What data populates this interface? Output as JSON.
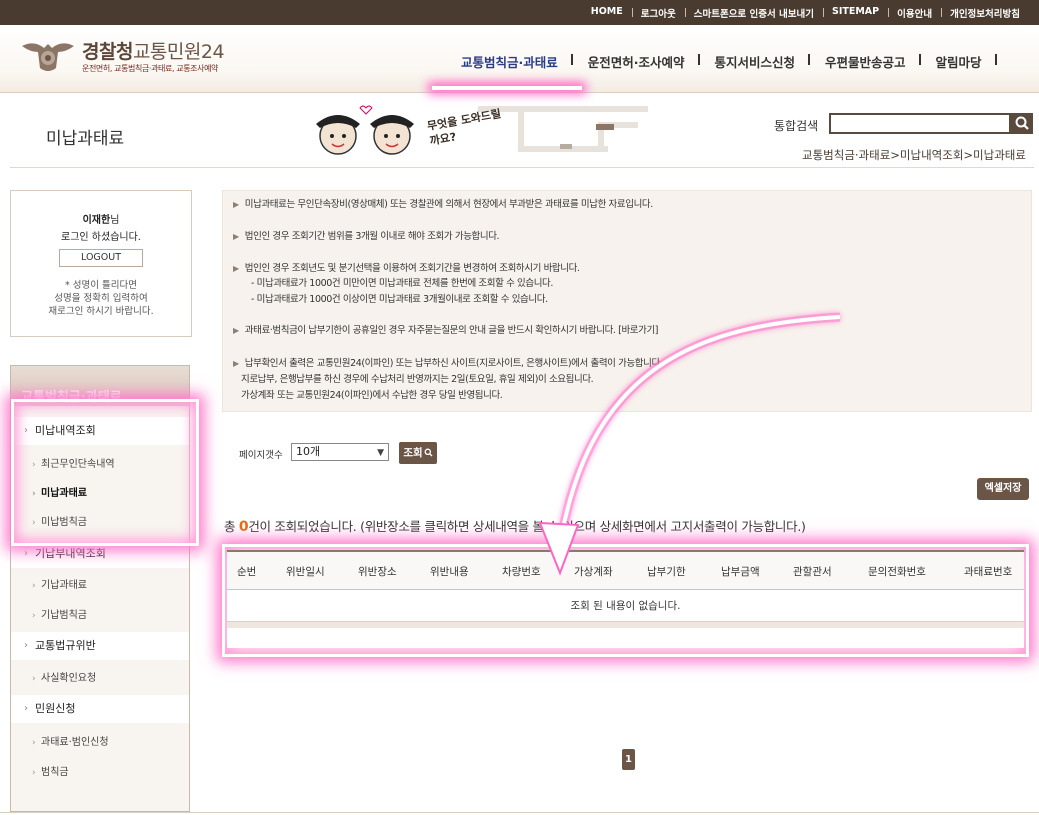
{
  "topbar": {
    "links": [
      "HOME",
      "로그아웃",
      "스마트폰으로 인증서 내보내기",
      "SITEMAP",
      "이용안내",
      "개인정보처리방침"
    ]
  },
  "header": {
    "logo_title_1": "경찰청",
    "logo_title_2": "교통민원24",
    "logo_sub": "운전면허, 교통범칙금·과태료, 교통조사예약",
    "gnb": [
      "교통범칙금·과태료",
      "운전면허·조사예약",
      "통지서비스신청",
      "우편물반송공고",
      "알림마당"
    ],
    "active_gnb_index": 0
  },
  "page": {
    "title": "미납과태료",
    "illust_text": "무엇을 도와드릴까요?",
    "search_label": "통합검색",
    "search_value": "",
    "breadcrumb": "교통범칙금·과태료>미납내역조회>미납과태료"
  },
  "login": {
    "user": "이재한",
    "suffix": "님",
    "welcome": "로그인 하셨습니다.",
    "logout_label": "LOGOUT",
    "note_1": "* 성명이 틀리다면",
    "note_2": "성명을 정확히 입력하여",
    "note_3": "재로그인 하시기 바랍니다."
  },
  "lnb": {
    "title": "교통범칙금·과태료",
    "items": [
      {
        "type": "main",
        "label": "미납내역조회"
      },
      {
        "type": "sub",
        "label": "최근무인단속내역"
      },
      {
        "type": "sub",
        "label": "미납과태료",
        "current": true
      },
      {
        "type": "sub",
        "label": "미납범칙금"
      },
      {
        "type": "main",
        "label": "기납부내역조회"
      },
      {
        "type": "sub",
        "label": "기납과태료"
      },
      {
        "type": "sub",
        "label": "기납범칙금"
      },
      {
        "type": "main",
        "label": "교통법규위반"
      },
      {
        "type": "sub",
        "label": "사실확인요청"
      },
      {
        "type": "main",
        "label": "민원신청"
      },
      {
        "type": "sub",
        "label": "과태료·범인신청"
      },
      {
        "type": "sub",
        "label": "범칙금"
      }
    ]
  },
  "info": {
    "items": [
      "미납과태료는 무인단속장비(영상매체) 또는 경찰관에 의해서 현장에서 부과받은 과태료를 미납한 자료입니다.",
      "법인인 경우 조회기간 범위를 3개월 이내로 해야 조회가 가능합니다.",
      "법인인 경우 조회년도 및 분기선택을 이용하여 조회기간을 변경하여 조회하시기 바랍니다.",
      "- 미납과태료가 1000건 미만이면 미납과태료 전체를 한번에 조회할 수 있습니다.",
      "- 미납과태료가 1000건 이상이면 미납과태료 3개월이내로 조회할 수 있습니다.",
      "과태료·범칙금이 납부기한이 공휴일인 경우 자주묻는질문의 안내 글을 반드시 확인하시기 바랍니다. [바로가기]",
      "납부확인서 출력은 교통민원24(이파인) 또는 납부하신 사이트(지로사이트, 은행사이트)에서 출력이 가능합니다.",
      "지로납부, 은행납부를 하신 경우에 수납처리 반영까지는 2일(토요일, 휴일 제외)이 소요됩니다.",
      "가상계좌 또는 교통민원24(이파인)에서 수납한 경우 당일 반영됩니다."
    ]
  },
  "controls": {
    "pagecount_label": "페이지갯수",
    "pagecount_value": "10개",
    "query_label": "조회",
    "excel_label": "엑셀저장"
  },
  "result": {
    "prefix": "총 ",
    "count": "0",
    "suffix": "건이 조회되었습니다. (위반장소를 클릭하면 상세내역을 볼 수 있으며 상세화면에서 고지서출력이 가능합니다.)"
  },
  "table": {
    "columns": [
      "순번",
      "위반일시",
      "위반장소",
      "위반내용",
      "차량번호",
      "가상계좌",
      "납부기한",
      "납부금액",
      "관할관서",
      "문의전화번호",
      "과태료번호"
    ],
    "empty_text": "조회 된 내용이 없습니다."
  },
  "pager": {
    "current": "1"
  },
  "colors": {
    "brand_brown": "#4a3b30",
    "button_brown": "#6b5547",
    "active_nav": "#2b3d88",
    "highlight_pink": "#ff66c4",
    "count_orange": "#e56b10"
  }
}
